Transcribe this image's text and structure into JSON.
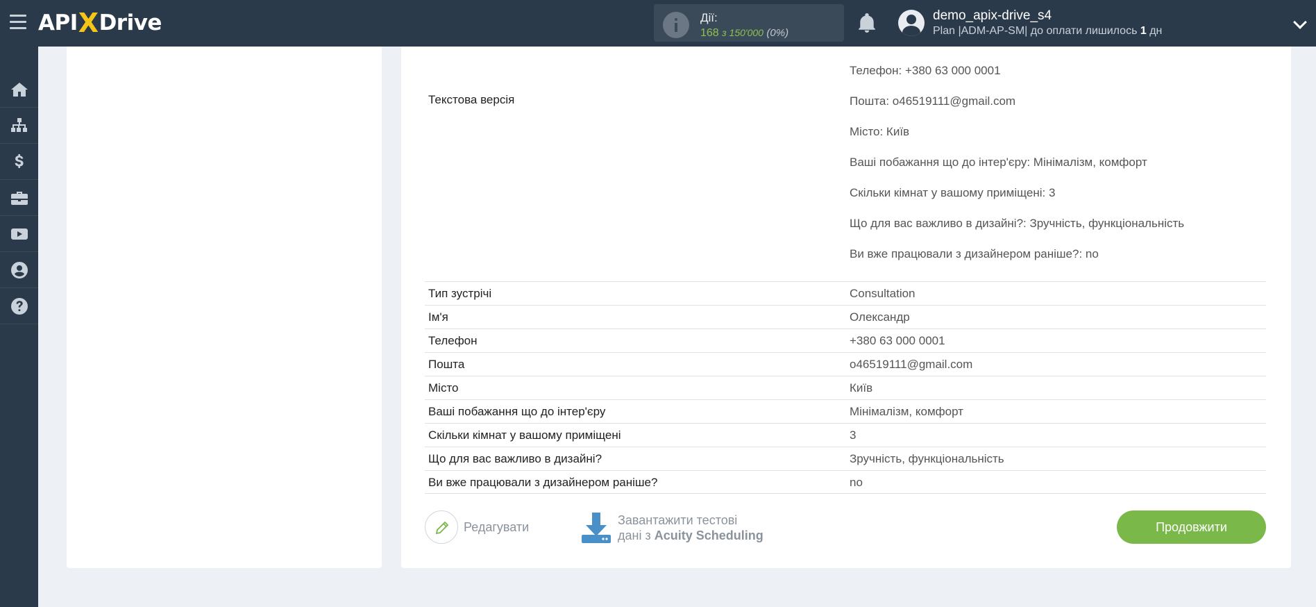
{
  "header": {
    "logo": {
      "part1": "API",
      "x": "X",
      "part2": "Drive"
    },
    "actions": {
      "title": "Дії:",
      "count": "168",
      "of_label": "з 150'000",
      "percent": "(0%)"
    },
    "user": {
      "name": "demo_apix-drive_s4",
      "plan_prefix": "Plan |ADM-AP-SM| до оплати лишилось ",
      "days": "1",
      "days_suffix": " дн"
    }
  },
  "sidebar": {
    "items": [
      {
        "icon": "home-icon"
      },
      {
        "icon": "sitemap-icon"
      },
      {
        "icon": "dollar-icon"
      },
      {
        "icon": "briefcase-icon"
      },
      {
        "icon": "youtube-icon"
      },
      {
        "icon": "user-circle-icon"
      },
      {
        "icon": "question-icon"
      }
    ]
  },
  "main": {
    "text_version_label": "Текстова версія",
    "text_version_lines": [
      "Телефон: +380 63 000 0001",
      "Пошта: o46519111@gmail.com",
      "Місто: Київ",
      "Ваші побажання що до інтер'єру: Мінімалізм, комфорт",
      "Скільки кімнат у вашому приміщені: 3",
      "Що для вас важливо в дизайні?: Зручність, функціональність",
      "Ви вже працювали з дизайнером раніше?: no"
    ],
    "rows": [
      {
        "key": "Тип зустрічі",
        "value": "Consultation"
      },
      {
        "key": "Ім'я",
        "value": "Олександр"
      },
      {
        "key": "Телефон",
        "value": "+380 63 000 0001"
      },
      {
        "key": "Пошта",
        "value": "o46519111@gmail.com"
      },
      {
        "key": "Місто",
        "value": "Київ"
      },
      {
        "key": "Ваші побажання що до інтер'єру",
        "value": "Мінімалізм, комфорт"
      },
      {
        "key": "Скільки кімнат у вашому приміщені",
        "value": "3"
      },
      {
        "key": "Що для вас важливо в дизайні?",
        "value": "Зручність, функціональність"
      },
      {
        "key": "Ви вже працювали з дизайнером раніше?",
        "value": "no"
      }
    ],
    "edit_label": "Редагувати",
    "download_line1": "Завантажити тестові",
    "download_line2_prefix": "дані з ",
    "download_line2_service": "Acuity Scheduling",
    "continue_label": "Продовжити"
  },
  "colors": {
    "topbar": "#2b3a4a",
    "accent_green": "#7bb84a",
    "logo_x": "#f5c518",
    "download_blue": "#4a90c8"
  }
}
